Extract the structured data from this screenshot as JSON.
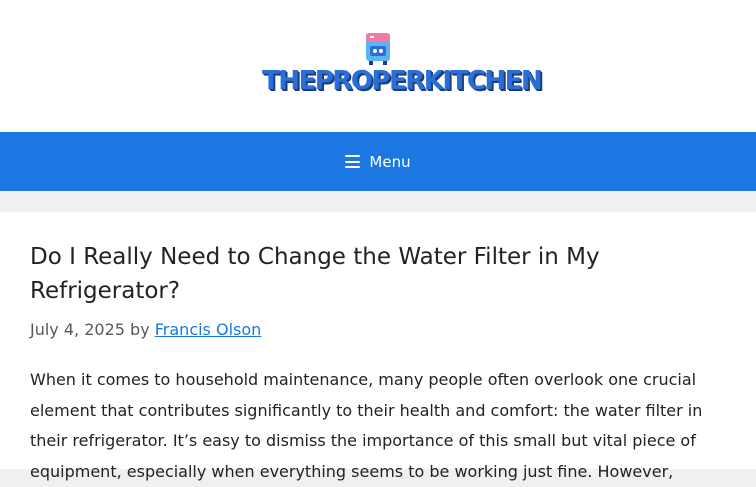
{
  "header": {
    "logo_text": "THEPROPERKITCHEN"
  },
  "nav": {
    "menu_label": "Menu"
  },
  "article": {
    "title": "Do I Really Need to Change the Water Filter in My Refrigerator?",
    "date": "July 4, 2025",
    "by": "by",
    "author": "Francis Olson",
    "body": "When it comes to household maintenance, many people often overlook one crucial element that contributes significantly to their health and comfort: the water filter in their refrigerator. It’s easy to dismiss the importance of this small but vital piece of equipment, especially when everything seems to be working just fine. However,"
  },
  "colors": {
    "nav_background": "#1b78e2",
    "logo_text": "#2b6fd6",
    "link": "#1b78e2"
  },
  "icons": {
    "logo": "fridge-icon",
    "menu": "hamburger-icon"
  }
}
